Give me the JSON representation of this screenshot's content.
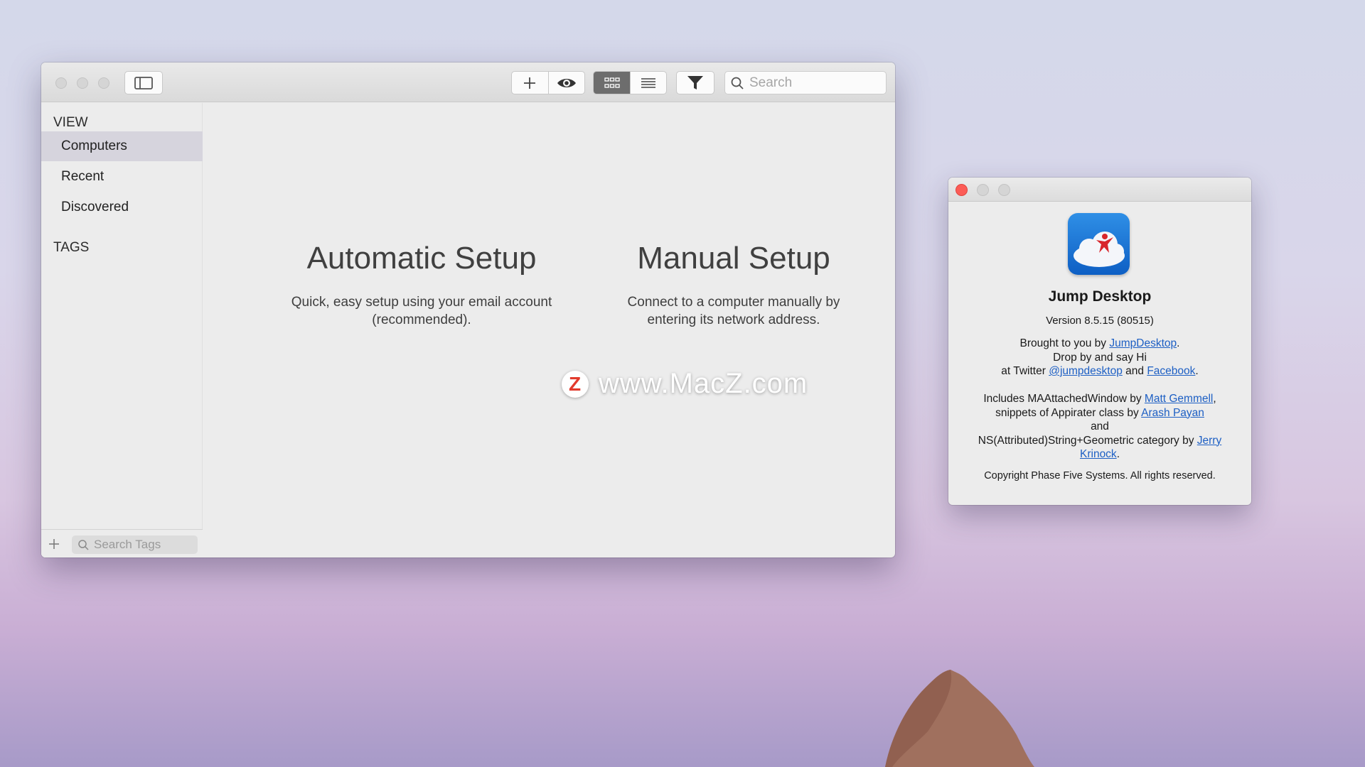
{
  "main_window": {
    "toolbar": {
      "search_placeholder": "Search"
    },
    "sidebar": {
      "view_heading": "VIEW",
      "items": [
        {
          "label": "Computers",
          "selected": true
        },
        {
          "label": "Recent",
          "selected": false
        },
        {
          "label": "Discovered",
          "selected": false
        }
      ],
      "tags_heading": "TAGS",
      "tag_search_placeholder": "Search Tags"
    },
    "content": {
      "automatic": {
        "title": "Automatic Setup",
        "desc_line1": "Quick, easy setup using your email account",
        "desc_line2": "(recommended)."
      },
      "manual": {
        "title": "Manual Setup",
        "desc_line1": "Connect to a computer manually by",
        "desc_line2": "entering its network address."
      }
    }
  },
  "watermark": {
    "logo_letter": "Z",
    "text": "www.MacZ.com"
  },
  "about_window": {
    "app_name": "Jump Desktop",
    "version": "Version 8.5.15 (80515)",
    "brought_prefix": "Brought to you by ",
    "brought_link": "JumpDesktop",
    "brought_suffix": ".",
    "drop_by": "Drop by and say Hi",
    "twitter_prefix": "at Twitter ",
    "twitter_link": "@jumpdesktop",
    "and_word": " and ",
    "facebook_link": "Facebook",
    "period": ".",
    "includes_prefix": "Includes MAAttachedWindow by ",
    "gemmell_link": "Matt Gemmell",
    "comma": ",",
    "snippets_prefix": "snippets of Appirater class by ",
    "payan_link": "Arash Payan",
    "and_line": "and",
    "ns_prefix": "NS(Attributed)String+Geometric category by ",
    "krinock_link_1": "Jerry",
    "krinock_link_2": "Krinock",
    "copyright": "Copyright Phase Five Systems. All rights reserved."
  },
  "colors": {
    "accent_link": "#1d5fc4",
    "close_red": "#fc5c56",
    "app_icon_blue": "#1f76d6"
  }
}
